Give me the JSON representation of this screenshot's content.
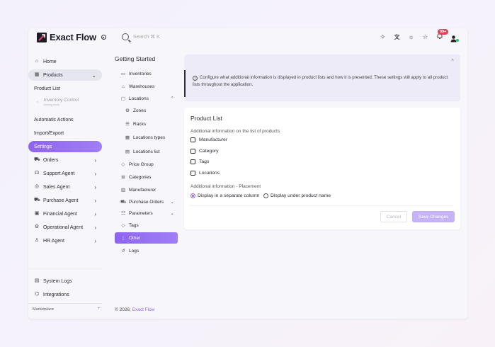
{
  "brand": {
    "name": "Exact Flow"
  },
  "search": {
    "placeholder": "Search ⌘ K"
  },
  "topbar": {
    "icons": [
      "sparkle-icon",
      "translate-icon",
      "sun-icon",
      "star-icon",
      "bell-icon",
      "user-icon"
    ],
    "notification_count": "99+"
  },
  "sidebar": {
    "items": [
      {
        "label": "Home",
        "icon": "home-icon"
      },
      {
        "label": "Products",
        "icon": "box-icon"
      },
      {
        "label": "Product List"
      },
      {
        "label": "Inventory Control",
        "hint": "(coming soon)"
      },
      {
        "label": "Automatic Actions"
      },
      {
        "label": "Import/Export"
      },
      {
        "label": "Settings"
      },
      {
        "label": "Orders",
        "icon": "cart-icon"
      },
      {
        "label": "Support Agent",
        "icon": "headset-icon"
      },
      {
        "label": "Sales Agent",
        "icon": "coin-icon"
      },
      {
        "label": "Purchase Agent",
        "icon": "cart-icon"
      },
      {
        "label": "Financial Agent",
        "icon": "wallet-icon"
      },
      {
        "label": "Operational Agent",
        "icon": "gear-icon"
      },
      {
        "label": "HR Agent",
        "icon": "person-icon"
      }
    ],
    "bottom": [
      {
        "label": "System Logs",
        "icon": "log-icon"
      },
      {
        "label": "Integrations",
        "icon": "plug-icon"
      }
    ],
    "marketplace": "Marketplace",
    "marketplace_plus": "+"
  },
  "settings_nav": {
    "title": "Getting Started",
    "items": [
      {
        "label": "Inventories"
      },
      {
        "label": "Warehouses"
      },
      {
        "label": "Locations"
      },
      {
        "label": "Zones"
      },
      {
        "label": "Racks"
      },
      {
        "label": "Locations types"
      },
      {
        "label": "Locations list"
      },
      {
        "label": "Price Group"
      },
      {
        "label": "Categories"
      },
      {
        "label": "Manufacturer"
      },
      {
        "label": "Purchase Orders"
      },
      {
        "label": "Parameters"
      },
      {
        "label": "Tags"
      },
      {
        "label": "Other"
      },
      {
        "label": "Logs"
      }
    ]
  },
  "footer": {
    "copyright": "© 2026,",
    "brand": "Exact Flow"
  },
  "info": {
    "text": "Configure what additional information is displayed in product lists and how it is presented. These settings will apply to all product lists throughout the application."
  },
  "product_list": {
    "title": "Product List",
    "additional_label": "Additional information on the list of products",
    "checkboxes": [
      "Manufacturer",
      "Category",
      "Tags",
      "Locations"
    ],
    "placement_label": "Additional information - Placement",
    "placement_options": [
      "Display in a separate column",
      "Display under product name"
    ],
    "selected_placement": "Display in a separate column",
    "cancel_label": "Cancel",
    "save_label": "Save Changes"
  },
  "colors": {
    "accent": "#8e64ef",
    "badge": "#e0435a",
    "status_dot": "#2ec26a"
  }
}
